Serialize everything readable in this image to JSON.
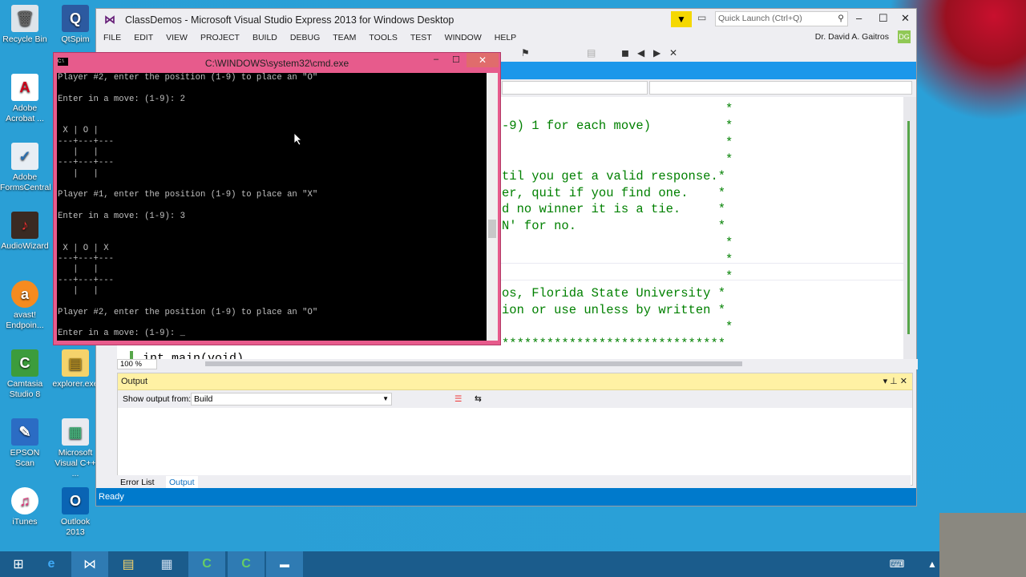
{
  "desktop_icons": [
    {
      "label": "Recycle Bin",
      "icon": "recycle-bin-icon"
    },
    {
      "label": "QtSpim",
      "icon": "qtspim-icon"
    },
    {
      "label": "Adobe Acrobat ...",
      "icon": "adobe-acrobat-icon"
    },
    {
      "label": "Adobe FormsCentral",
      "icon": "forms-central-icon"
    },
    {
      "label": "AudioWizard",
      "icon": "audiowizard-icon"
    },
    {
      "label": "avast! Endpoin...",
      "icon": "avast-icon"
    },
    {
      "label": "Camtasia Studio 8",
      "icon": "camtasia-icon"
    },
    {
      "label": "explorer.exe",
      "icon": "folder-icon"
    },
    {
      "label": "EPSON Scan",
      "icon": "scanner-icon"
    },
    {
      "label": "Microsoft Visual C++ ...",
      "icon": "visual-cpp-icon"
    },
    {
      "label": "iTunes",
      "icon": "itunes-icon"
    },
    {
      "label": "Outlook 2013",
      "icon": "outlook-icon"
    }
  ],
  "vs": {
    "title": "ClassDemos - Microsoft Visual Studio Express 2013 for Windows Desktop",
    "quick_launch": "Quick Launch (Ctrl+Q)",
    "menu": [
      "FILE",
      "EDIT",
      "VIEW",
      "PROJECT",
      "BUILD",
      "DEBUG",
      "TEAM",
      "TOOLS",
      "TEST",
      "WINDOW",
      "HELP"
    ],
    "user": "Dr. David A. Gaitros",
    "user_initials": "DG",
    "editor_lines": [
      "                              *",
      "-9) 1 for each move)          *",
      "                              *",
      "                              *",
      "til you get a valid response.*",
      "er, quit if you find one.    *",
      "d no winner it is a tie.     *",
      "N' for no.                   *",
      "                              *",
      "                              *",
      "                              *",
      "os, Florida State University *",
      "ion or use unless by written *",
      "                              *",
      "******************************"
    ],
    "code_bottom": "int main(void)",
    "zoom": "100 %",
    "output_title": "Output",
    "show_output_label": "Show output from:",
    "show_output_value": "Build",
    "tabs": [
      "Error List",
      "Output"
    ],
    "status": "Ready"
  },
  "cmd": {
    "title": "C:\\WINDOWS\\system32\\cmd.exe",
    "lines": [
      "Player #2, enter the position (1-9) to place an \"O\"",
      "",
      "Enter in a move: (1-9): 2",
      "",
      "",
      " X | O |",
      "---+---+---",
      "   |   |",
      "---+---+---",
      "   |   |",
      "",
      "Player #1, enter the position (1-9) to place an \"X\"",
      "",
      "Enter in a move: (1-9): 3",
      "",
      "",
      " X | O | X",
      "---+---+---",
      "   |   |",
      "---+---+---",
      "   |   |",
      "",
      "Player #2, enter the position (1-9) to place an \"O\"",
      "",
      "Enter in a move: (1-9): _"
    ]
  }
}
